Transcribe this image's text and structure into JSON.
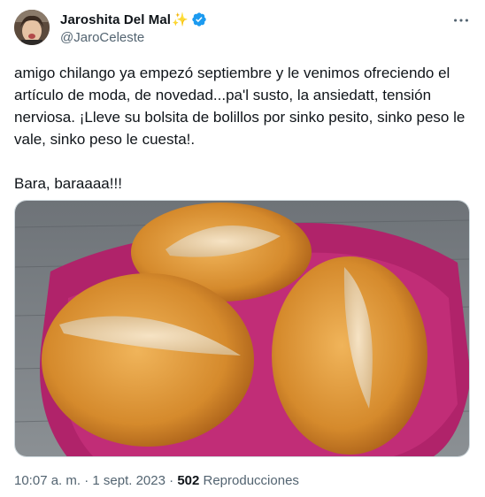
{
  "author": {
    "display_name": "Jaroshita Del Mal",
    "sparkle": "✨",
    "handle": "@JaroCeleste",
    "verified": true
  },
  "tweet": {
    "text": "amigo chilango ya empezó septiembre y le venimos ofreciendo el artículo de moda, de novedad...pa'l susto, la ansiedatt, tensión nerviosa. ¡Lleve su bolsita de bolillos por sinko pesito, sinko peso le vale, sinko peso le cuesta!.\n\nBara, baraaaa!!!"
  },
  "meta": {
    "time": "10:07 a. m.",
    "separator1": " · ",
    "date": "1 sept. 2023",
    "separator2": " · ",
    "views_count": "502",
    "views_label": " Reproducciones"
  },
  "colors": {
    "verified_blue": "#1d9bf0",
    "secondary_text": "#536471",
    "primary_text": "#0f1419"
  },
  "icons": {
    "more": "more-horizontal-icon",
    "verified": "verified-badge-icon"
  }
}
